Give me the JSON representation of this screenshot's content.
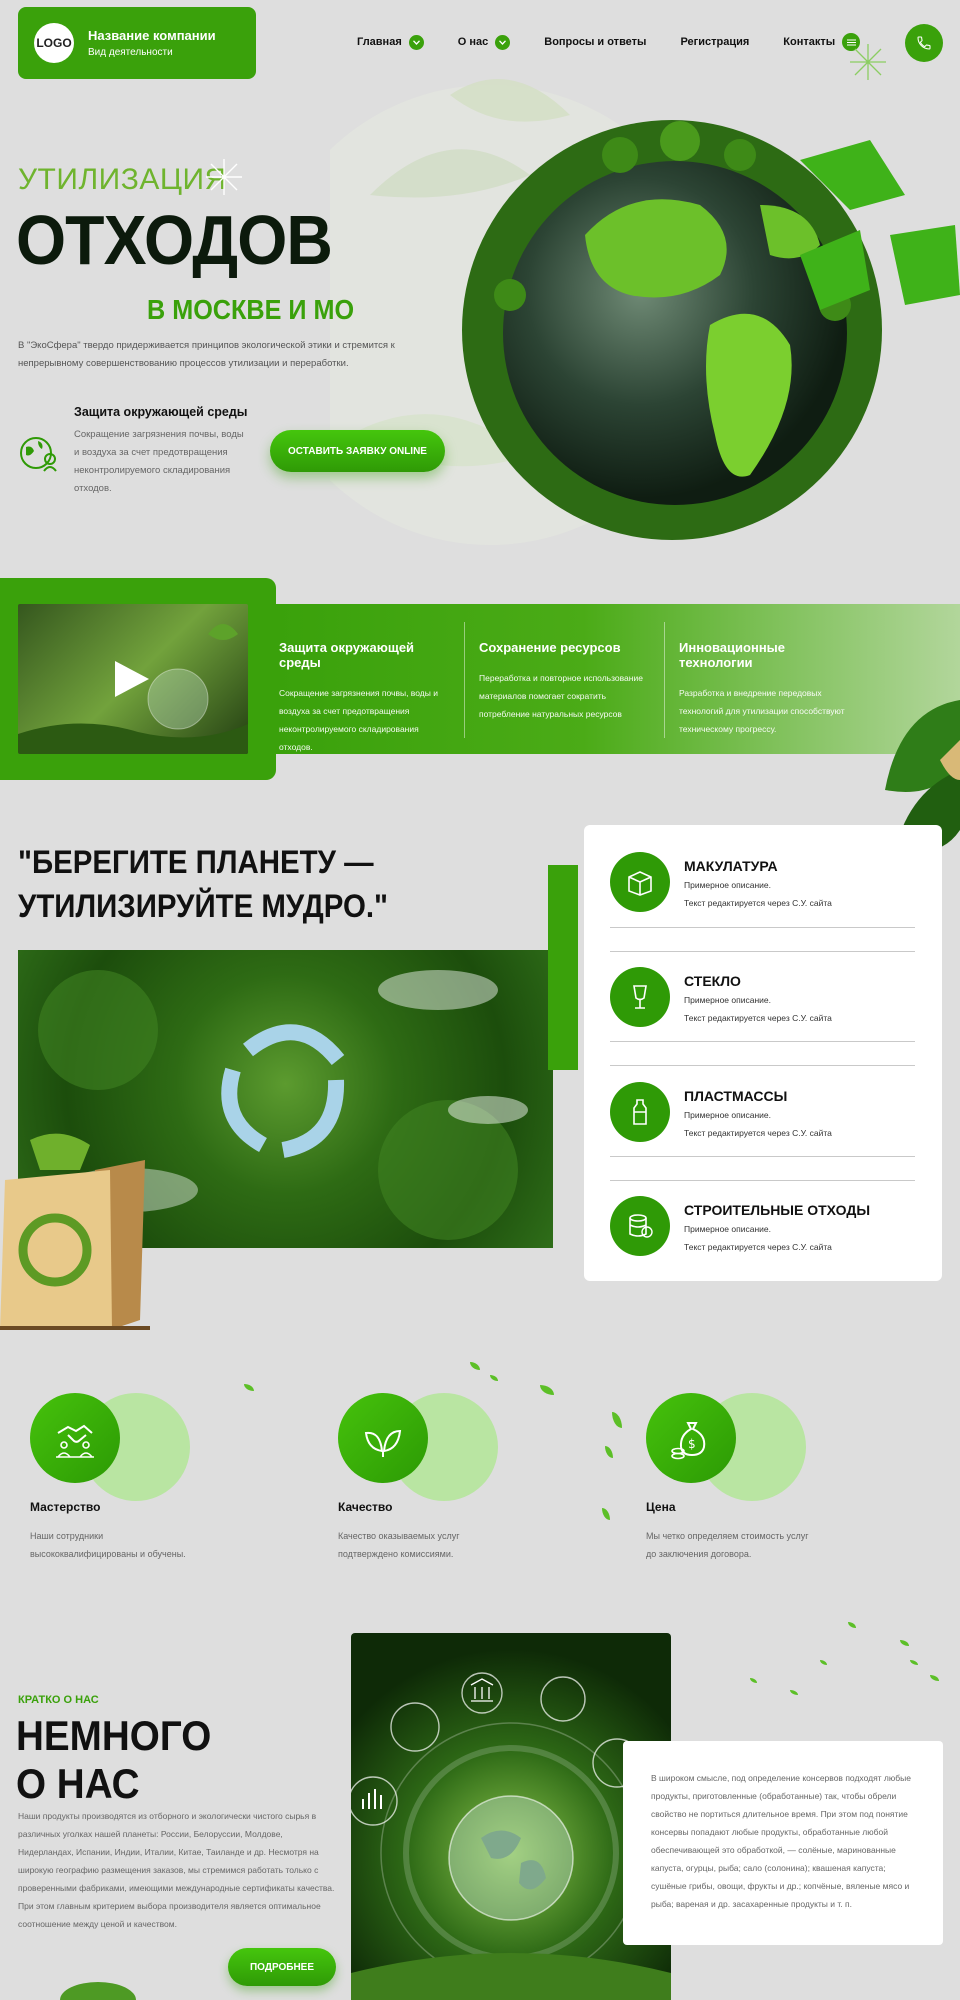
{
  "header": {
    "logo_text": "LOGO",
    "company_name": "Название компании",
    "company_activity": "Вид деятельности",
    "nav": [
      {
        "label": "Главная",
        "has_dropdown": true
      },
      {
        "label": "О нас",
        "has_dropdown": true
      },
      {
        "label": "Вопросы и ответы",
        "has_dropdown": false
      },
      {
        "label": "Регистрация",
        "has_dropdown": false
      },
      {
        "label": "Контакты",
        "has_dropdown": false,
        "has_menu_icon": true
      }
    ]
  },
  "hero": {
    "kicker": "УТИЛИЗАЦИЯ",
    "title": "ОТХОДОВ",
    "subtitle": "В МОСКВЕ И МО",
    "description": "В \"ЭкоСфера\" твердо придерживается принципов экологической этики и стремится к непрерывному совершенствованию процессов утилизации и переработки.",
    "protection_title": "Защита окружающей среды",
    "protection_desc": "Сокращение загрязнения почвы, воды и воздуха за счет предотвращения неконтролируемого складирования отходов.",
    "cta_label": "ОСТАВИТЬ ЗАЯВКУ ONLINE"
  },
  "features": [
    {
      "title": "Защита окружающей среды",
      "desc": "Сокращение загрязнения почвы, воды и воздуха за счет предотвращения неконтролируемого складирования отходов."
    },
    {
      "title": "Сохранение ресурсов",
      "desc": "Переработка и повторное использование материалов помогает сократить потребление натуральных ресурсов"
    },
    {
      "title": "Инновационные технологии",
      "desc": "Разработка и внедрение передовых технологий для утилизации способствуют техническому прогрессу."
    }
  ],
  "quote": {
    "line1": "\"БЕРЕГИТЕ ПЛАНЕТУ —",
    "line2": "УТИЛИЗИРУЙТЕ МУДРО.\""
  },
  "categories": [
    {
      "title": "МАКУЛАТУРА",
      "d1": "Примерное описание.",
      "d2": "Текст редактируется через С.У. сайта",
      "icon": "box-icon"
    },
    {
      "title": "СТЕКЛО",
      "d1": "Примерное описание.",
      "d2": "Текст редактируется через С.У. сайта",
      "icon": "glass-icon"
    },
    {
      "title": "ПЛАСТМАССЫ",
      "d1": "Примерное описание.",
      "d2": "Текст редактируется через С.У. сайта",
      "icon": "bottle-icon"
    },
    {
      "title": "СТРОИТЕЛЬНЫЕ ОТХОДЫ",
      "d1": "Примерное описание.",
      "d2": "Текст редактируется через С.У. сайта",
      "icon": "barrel-icon"
    }
  ],
  "advantages": [
    {
      "title": "Мастерство",
      "desc": "Наши сотрудники высококвалифицированы и обучены.",
      "icon": "handshake-icon"
    },
    {
      "title": "Качество",
      "desc": "Качество оказываемых услуг подтверждено комиссиями.",
      "icon": "leaf-icon"
    },
    {
      "title": "Цена",
      "desc": "Мы четко определяем стоимость услуг до заключения договора.",
      "icon": "money-bag-icon"
    }
  ],
  "about": {
    "kicker": "КРАТКО О НАС",
    "title_line1": "НЕМНОГО",
    "title_line2": "О НАС",
    "description": "Наши продукты производятся из отборного и экологически чистого сырья в различных уголках нашей планеты: России, Белоруссии, Молдове, Нидерландах, Испании, Индии, Италии, Китае, Таиланде и др. Несмотря на широкую географию размещения заказов, мы стремимся работать только с проверенными фабриками, имеющими международные сертификаты качества. При этом главным критерием выбора производителя является оптимальное соотношение между ценой и качеством.",
    "button_label": "ПОДРОБНЕЕ",
    "card_text": "В широком смысле, под определение консервов подходят любые продукты, приготовленные (обработанные) так, чтобы обрели свойство не портиться длительное время. При этом под понятие консервы попадают любые продукты, обработанные любой обеспечивающей это обработкой, — солёные, маринованные капуста, огурцы, рыба; сало (солонина); квашеная капуста; сушёные грибы, овощи, фрукты и др.; копчёные, вяленые мясо и рыба; вареная и др. засахаренные продукты и т. п."
  },
  "colors": {
    "accent": "#3aa10b",
    "light_accent": "#b9e5a2",
    "background": "#dedede"
  }
}
